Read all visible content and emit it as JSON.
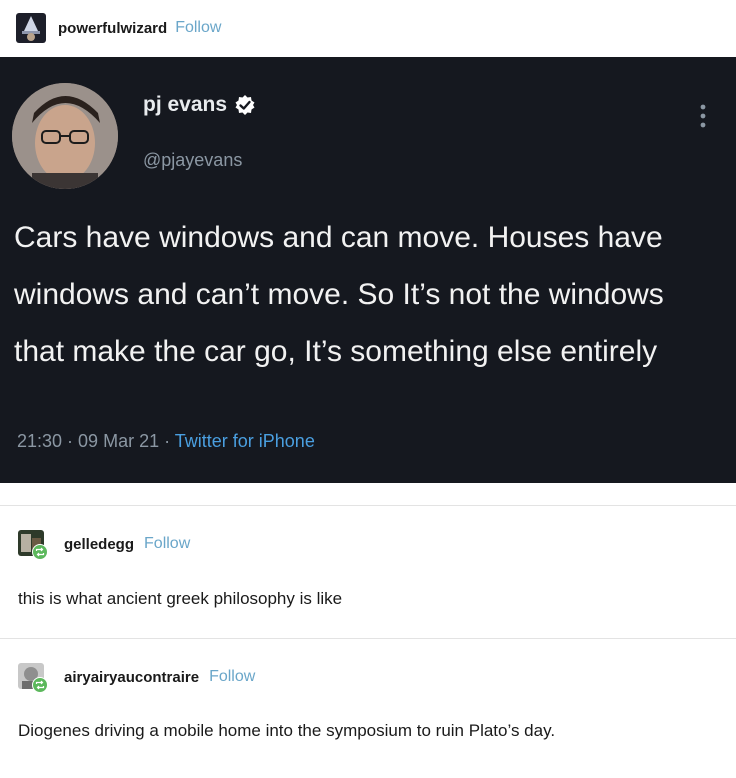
{
  "post": {
    "username": "powerfulwizard",
    "follow_label": "Follow"
  },
  "tweet": {
    "name": "pj evans",
    "handle": "@pjayevans",
    "text": "Cars have windows and can move. Houses have windows and can’t move. So It’s not the windows that make the car go, It’s something else entirely",
    "time": "21:30",
    "date": "09 Mar 21",
    "source": "Twitter for iPhone",
    "separator": " · "
  },
  "reblogs": [
    {
      "username": "gelledegg",
      "follow_label": "Follow",
      "text": "this is what ancient greek philosophy is like"
    },
    {
      "username": "airyairyaucontraire",
      "follow_label": "Follow",
      "text": "Diogenes driving a mobile home into the symposium to ruin Plato’s day."
    }
  ],
  "icons": {
    "verified": "verified-badge-icon",
    "more": "more-vertical-icon",
    "reblog_badge": "reblog-badge-icon"
  },
  "colors": {
    "tweet_background": "#15181f",
    "follow_link": "#6aa6c9",
    "twitter_link": "#4a9fe0",
    "badge_green": "#5cb85c"
  }
}
